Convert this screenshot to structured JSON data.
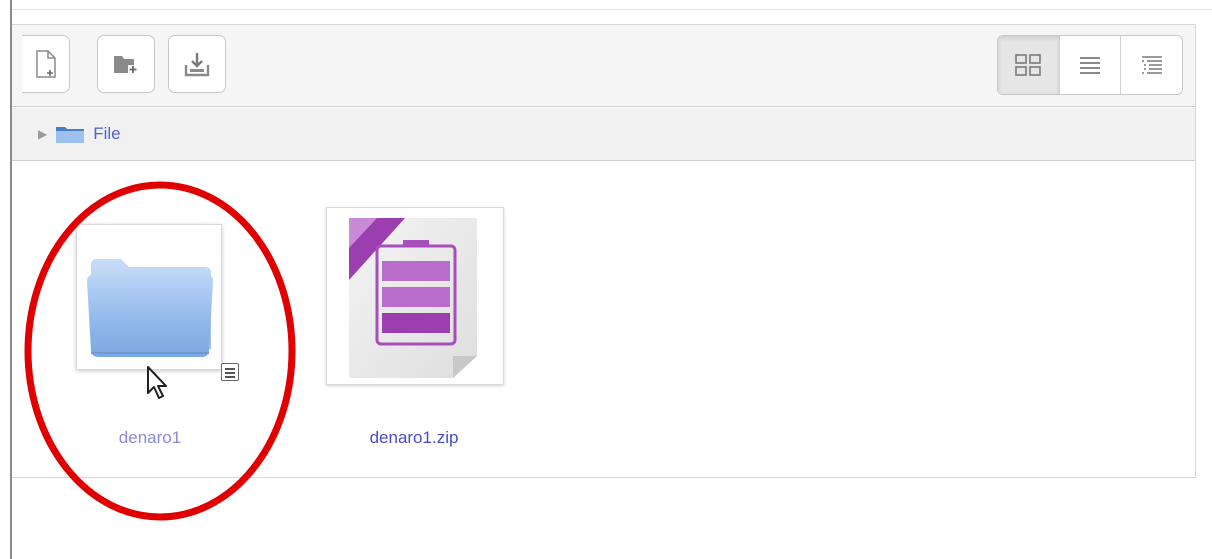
{
  "toolbar": {
    "buttons": [
      {
        "icon": "new-file-icon"
      },
      {
        "icon": "new-folder-icon"
      },
      {
        "icon": "download-icon"
      }
    ],
    "view_modes": [
      {
        "icon": "grid-view-icon",
        "active": true
      },
      {
        "icon": "list-view-icon",
        "active": false
      },
      {
        "icon": "tree-view-icon",
        "active": false
      }
    ]
  },
  "pathbar": {
    "label": "File",
    "icon": "folder-icon"
  },
  "items": [
    {
      "name": "denaro1",
      "type": "folder",
      "highlight": "red-circle"
    },
    {
      "name": "denaro1.zip",
      "type": "zip"
    }
  ],
  "colors": {
    "link": "#5060d8",
    "folder_label": "#8a8ad8",
    "zip_purple": "#9b3fb0",
    "highlight": "#e00000"
  }
}
